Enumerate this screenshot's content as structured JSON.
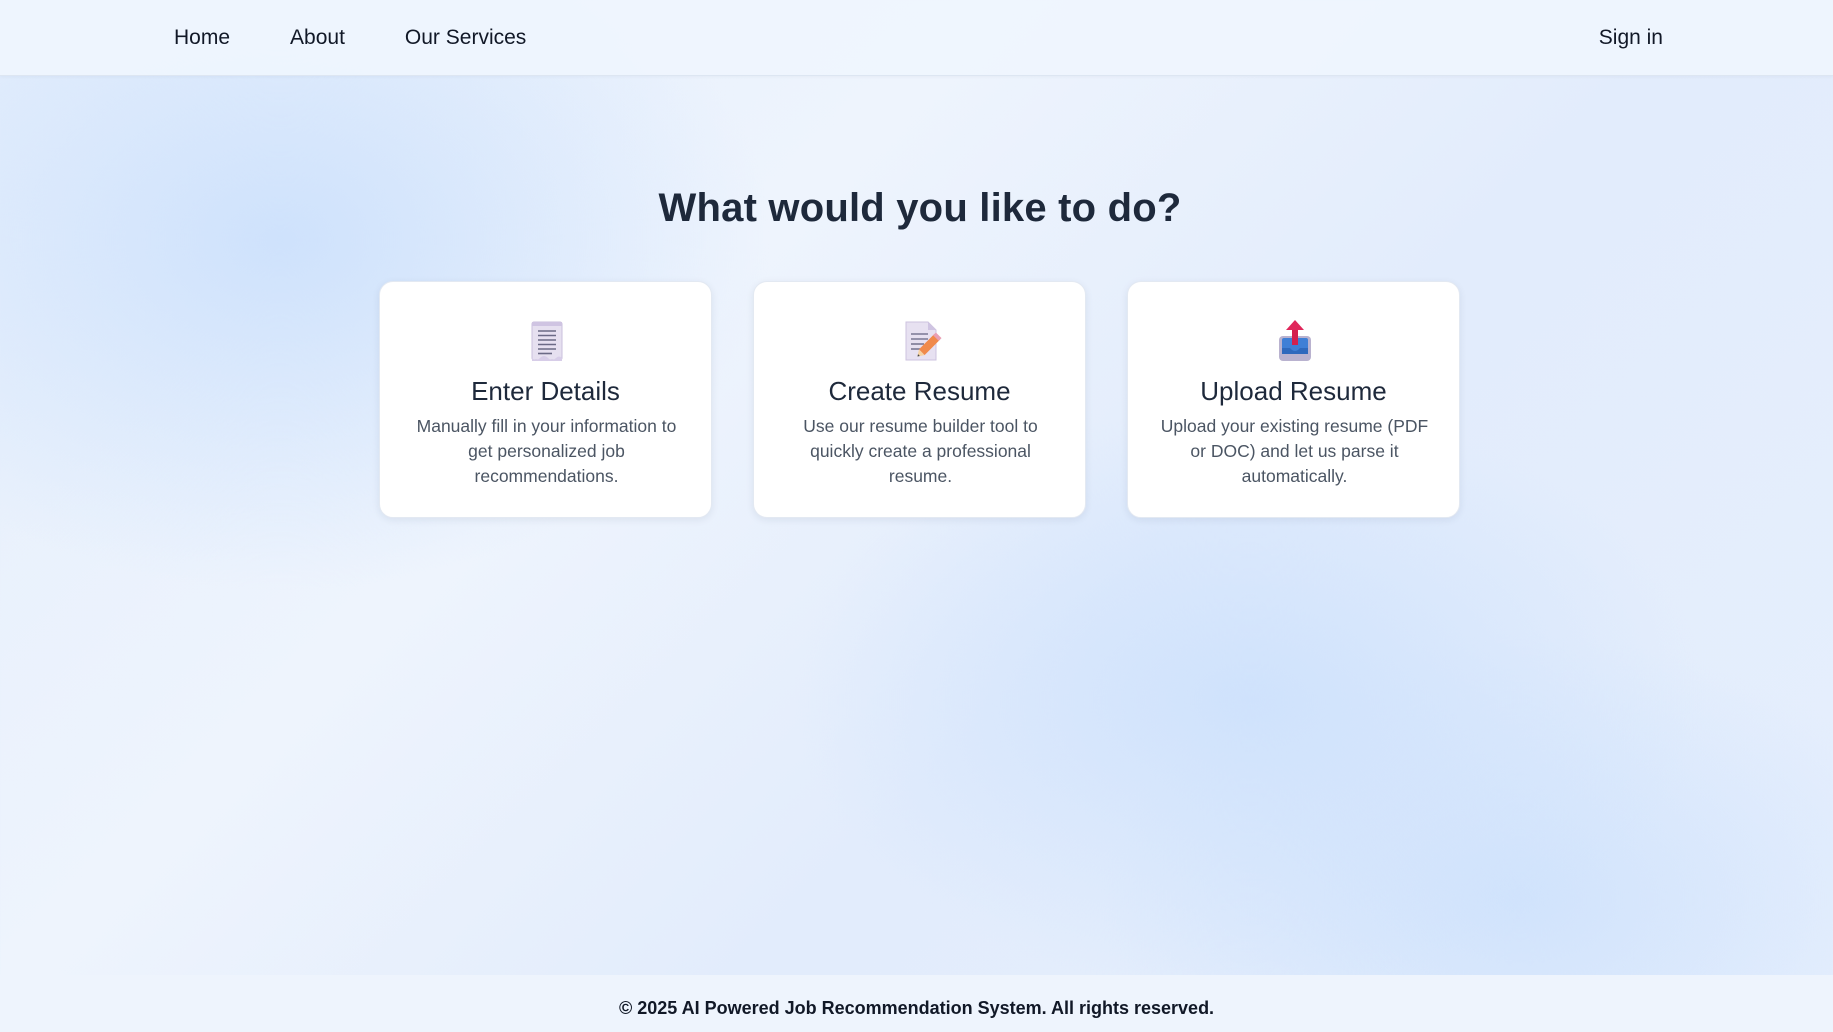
{
  "nav": {
    "items": [
      {
        "label": "Home"
      },
      {
        "label": "About"
      },
      {
        "label": "Our Services"
      }
    ],
    "signin_label": "Sign in"
  },
  "main": {
    "title": "What would you like to do?",
    "cards": [
      {
        "icon": "scroll-document-icon",
        "title": "Enter Details",
        "description": "Manually fill in your information to get personalized job recommendations."
      },
      {
        "icon": "memo-pencil-icon",
        "title": "Create Resume",
        "description": "Use our resume builder tool to quickly create a professional resume."
      },
      {
        "icon": "outbox-tray-icon",
        "title": "Upload Resume",
        "description": "Upload your existing resume (PDF or DOC) and let us parse it automatically."
      }
    ]
  },
  "footer": {
    "text": "© 2025 AI Powered Job Recommendation System. All rights reserved."
  },
  "colors": {
    "background": "#e4eefc",
    "card": "#ffffff",
    "title": "#1e293b",
    "body_text": "#4b5563"
  }
}
